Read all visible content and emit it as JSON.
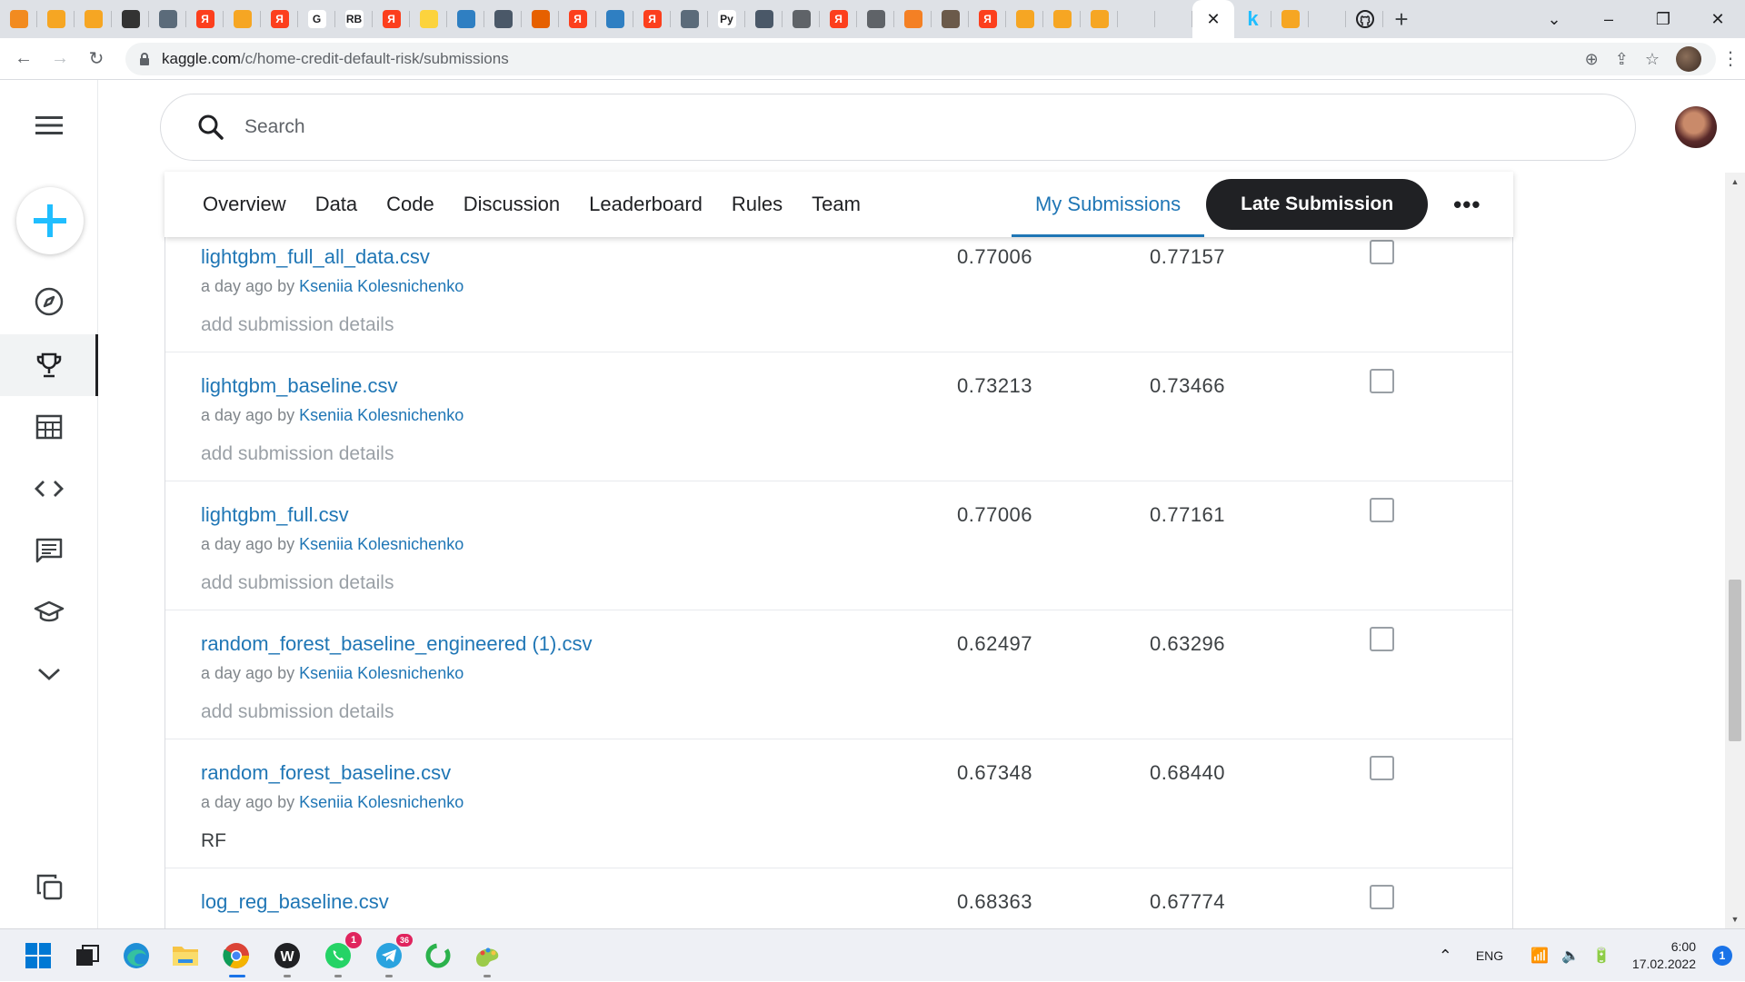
{
  "browser": {
    "url_host": "kaggle.com",
    "url_path": "/c/home-credit-default-risk/submissions",
    "tabs": [
      {
        "icon": "loader-icon",
        "color": "#f28b20",
        "glyph": ""
      },
      {
        "icon": "document-icon",
        "color": "#f6a623",
        "glyph": ""
      },
      {
        "icon": "document-icon",
        "color": "#f6a623",
        "glyph": ""
      },
      {
        "icon": "chrome-web-icon",
        "color": "#333",
        "glyph": ""
      },
      {
        "icon": "image-icon",
        "color": "#5b6b7a",
        "glyph": ""
      },
      {
        "icon": "yandex-icon",
        "color": "#fc3f1d",
        "glyph": "Я"
      },
      {
        "icon": "chart-icon",
        "color": "#f6a623",
        "glyph": ""
      },
      {
        "icon": "yandex-icon",
        "color": "#fc3f1d",
        "glyph": "Я"
      },
      {
        "icon": "google-icon",
        "color": "#fff",
        "glyph": "G"
      },
      {
        "icon": "rb-icon",
        "color": "#fff",
        "glyph": "RB"
      },
      {
        "icon": "yandex-icon",
        "color": "#fc3f1d",
        "glyph": "Я"
      },
      {
        "icon": "yandex-zen-icon",
        "color": "#fcd33d",
        "glyph": ""
      },
      {
        "icon": "gear-icon",
        "color": "#2f7fc2",
        "glyph": ""
      },
      {
        "icon": "person-icon",
        "color": "#4a5868",
        "glyph": ""
      },
      {
        "icon": "firefox-icon",
        "color": "#e66000",
        "glyph": ""
      },
      {
        "icon": "yandex-icon",
        "color": "#fc3f1d",
        "glyph": "Я"
      },
      {
        "icon": "gear-icon",
        "color": "#2f7fc2",
        "glyph": ""
      },
      {
        "icon": "yandex-icon",
        "color": "#fc3f1d",
        "glyph": "Я"
      },
      {
        "icon": "image-icon",
        "color": "#5b6b7a",
        "glyph": ""
      },
      {
        "icon": "python-icon",
        "color": "#fff",
        "glyph": "Py"
      },
      {
        "icon": "book-icon",
        "color": "#4a5868",
        "glyph": ""
      },
      {
        "icon": "globe-icon",
        "color": "#5f6368",
        "glyph": ""
      },
      {
        "icon": "yandex-icon",
        "color": "#fc3f1d",
        "glyph": "Я"
      },
      {
        "icon": "globe-icon",
        "color": "#5f6368",
        "glyph": ""
      },
      {
        "icon": "stackoverflow-icon",
        "color": "#f48024",
        "glyph": ""
      },
      {
        "icon": "person-icon",
        "color": "#6b5a4a",
        "glyph": ""
      },
      {
        "icon": "yandex-icon",
        "color": "#fc3f1d",
        "glyph": "Я"
      },
      {
        "icon": "chart-icon",
        "color": "#f6a623",
        "glyph": ""
      },
      {
        "icon": "book-icon",
        "color": "#f6a623",
        "glyph": ""
      },
      {
        "icon": "book-icon",
        "color": "#f6a623",
        "glyph": ""
      },
      {
        "icon": "blank-icon",
        "color": "transparent",
        "glyph": ""
      },
      {
        "icon": "blank-icon",
        "color": "transparent",
        "glyph": ""
      }
    ]
  },
  "search": {
    "placeholder": "Search"
  },
  "competition_tabs": {
    "overview": "Overview",
    "data": "Data",
    "code": "Code",
    "discussion": "Discussion",
    "leaderboard": "Leaderboard",
    "rules": "Rules",
    "team": "Team",
    "my_submissions": "My Submissions",
    "late_submission": "Late Submission"
  },
  "submissions": [
    {
      "file": "lightgbm_full_all_data.csv",
      "when": "a day ago by",
      "user": "Kseniia Kolesnichenko",
      "description": "add submission details",
      "has_description": false,
      "private_score": "0.77006",
      "public_score": "0.77157"
    },
    {
      "file": "lightgbm_baseline.csv",
      "when": "a day ago by",
      "user": "Kseniia Kolesnichenko",
      "description": "add submission details",
      "has_description": false,
      "private_score": "0.73213",
      "public_score": "0.73466"
    },
    {
      "file": "lightgbm_full.csv",
      "when": "a day ago by",
      "user": "Kseniia Kolesnichenko",
      "description": "add submission details",
      "has_description": false,
      "private_score": "0.77006",
      "public_score": "0.77161"
    },
    {
      "file": "random_forest_baseline_engineered (1).csv",
      "when": "a day ago by",
      "user": "Kseniia Kolesnichenko",
      "description": "add submission details",
      "has_description": false,
      "private_score": "0.62497",
      "public_score": "0.63296"
    },
    {
      "file": "random_forest_baseline.csv",
      "when": "a day ago by",
      "user": "Kseniia Kolesnichenko",
      "description": "RF",
      "has_description": true,
      "private_score": "0.67348",
      "public_score": "0.68440"
    },
    {
      "file": "log_reg_baseline.csv",
      "when": "",
      "user": "",
      "description": "",
      "has_description": false,
      "private_score": "0.68363",
      "public_score": "0.67774"
    }
  ],
  "taskbar": {
    "whatsapp_badge": "1",
    "telegram_badge": "36",
    "lang": "ENG",
    "time": "6:00",
    "date": "17.02.2022",
    "notifications": "1"
  }
}
